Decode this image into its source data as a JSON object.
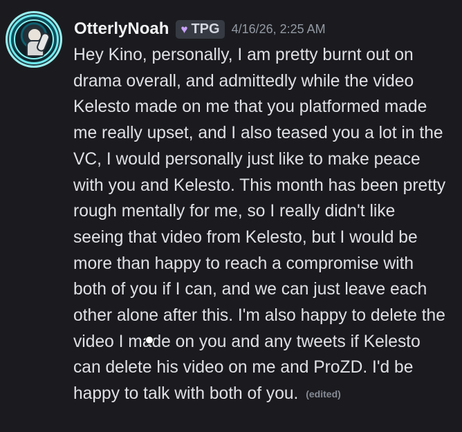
{
  "message": {
    "username": "OtterlyNoah",
    "tag": {
      "icon": "purple-heart-icon",
      "label": "TPG"
    },
    "timestamp": "4/16/26, 2:25 AM",
    "text": "Hey Kino, personally, I am pretty burnt out on drama overall, and admittedly while the video Kelesto made on me that you platformed made me really upset, and I also teased you a lot in the VC, I would personally just like to make peace with you and Kelesto. This month has been pretty rough mentally for me, so I really didn't like seeing that video from Kelesto, but I would be more than happy to reach a compromise with both of you if I can, and we can just leave each other alone after this. I'm also happy to delete the video I made on you and any tweets if Kelesto can delete his video on me and ProZD. I'd be happy to talk with both of you.",
    "edited_label": "(edited)"
  },
  "colors": {
    "background": "#1b1b1f",
    "username": "#f2f3f5",
    "message_text": "#dfe0e5",
    "timestamp": "#939aa4",
    "tag_background": "#363a42",
    "heart": "#c9a1ff",
    "avatar_accent": "#6de9ed"
  }
}
